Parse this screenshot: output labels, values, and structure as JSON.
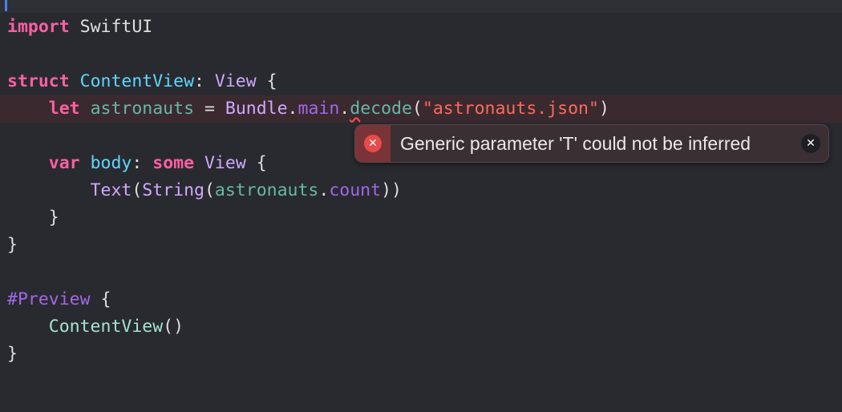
{
  "code": {
    "line1": {
      "kw": "import",
      "module": "SwiftUI"
    },
    "line3": {
      "kw": "struct",
      "name": "ContentView",
      "colon": ":",
      "proto": "View",
      "brace": "{"
    },
    "line4": {
      "indent": "    ",
      "kw": "let",
      "name": "astronauts",
      "eq": " = ",
      "bundle": "Bundle",
      "dot1": ".",
      "main": "main",
      "dot2": ".",
      "decode_d": "d",
      "decode_rest": "ecode",
      "open": "(",
      "str": "\"astronauts.json\"",
      "close": ")"
    },
    "line6": {
      "indent": "    ",
      "kw": "var",
      "name": "body",
      "colon": ": ",
      "some": "some",
      "view": "View",
      "brace": " {"
    },
    "line7": {
      "indent": "        ",
      "text": "Text",
      "p1": "(",
      "string": "String",
      "p2": "(",
      "astro": "astronauts",
      "dot": ".",
      "count": "count",
      "p3": "))"
    },
    "line8": {
      "text": "    }"
    },
    "line9": {
      "text": "}"
    },
    "line11": {
      "macro": "#Preview",
      "brace": " {"
    },
    "line12": {
      "indent": "    ",
      "ctor": "ContentView",
      "parens": "()"
    },
    "line13": {
      "text": "}"
    }
  },
  "issue": {
    "icon": "error-x-circle-icon",
    "message": "Generic parameter 'T' could not be inferred",
    "close_icon": "close-icon",
    "error_color": "#e84b4b"
  }
}
